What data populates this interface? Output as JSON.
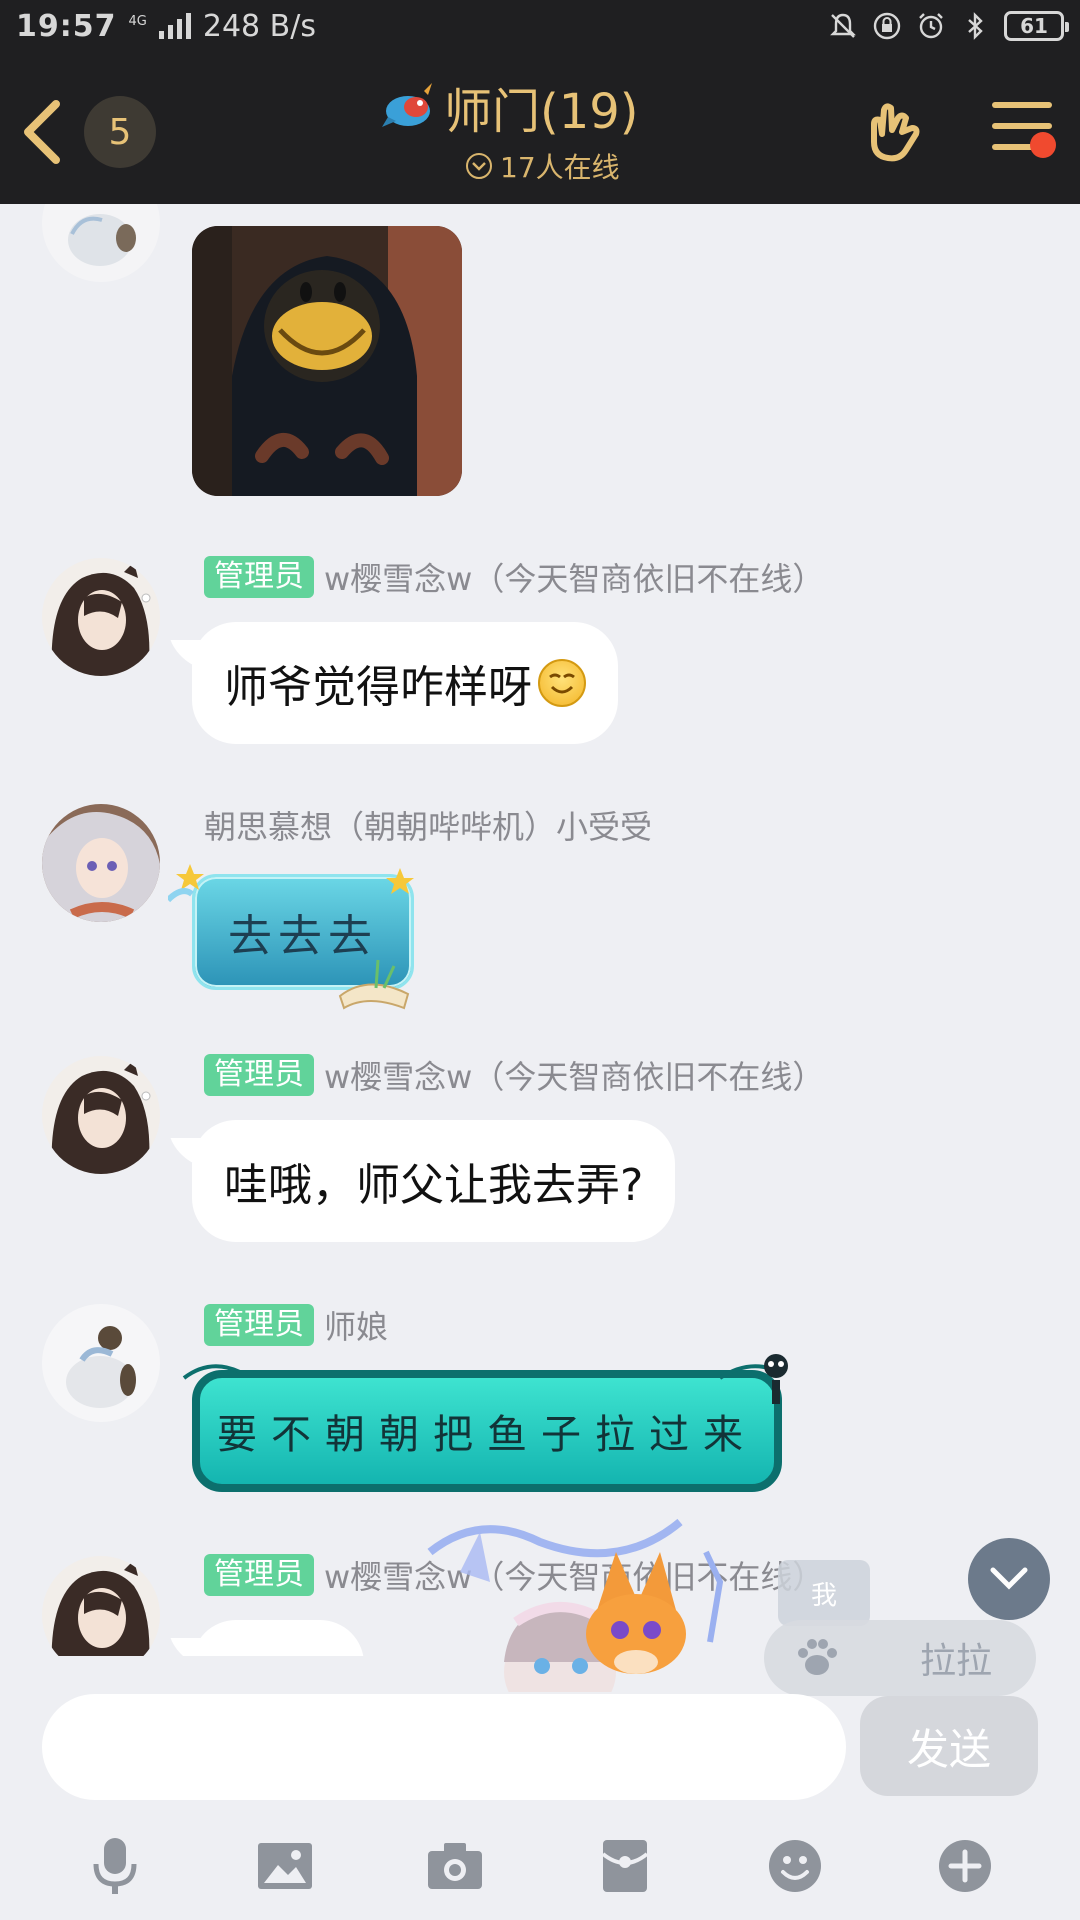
{
  "status_bar": {
    "time": "19:57",
    "network_type": "4G",
    "speed": "248 B/s",
    "battery": "61"
  },
  "header": {
    "unread_count": "5",
    "group_title": "师门(19)",
    "online_text": "17人在线"
  },
  "messages": [
    {
      "type": "image"
    },
    {
      "role": "管理员",
      "sender": "w樱雪念w（今天智商依旧不在线）",
      "text": "师爷觉得咋样呀"
    },
    {
      "role": "",
      "sender": "朝思慕想（朝朝哔哔机）小受受",
      "text": "去去去"
    },
    {
      "role": "管理员",
      "sender": "w樱雪念w（今天智商依旧不在线）",
      "text": "哇哦，师父让我去弄?"
    },
    {
      "role": "管理员",
      "sender": "师娘",
      "text": "要不朝朝把鱼子拉过来"
    },
    {
      "role": "管理员",
      "sender": "w樱雪念w（今天智商依旧不在线）",
      "text": ""
    }
  ],
  "overlay": {
    "me_label": "我",
    "pat_label": "拉拉"
  },
  "input": {
    "value": "",
    "send_label": "发送"
  },
  "toolbar": {
    "icons": [
      "microphone-icon",
      "image-icon",
      "camera-icon",
      "red-packet-icon",
      "emoji-icon",
      "plus-icon"
    ]
  },
  "colors": {
    "header_bg": "#1f1f21",
    "accent_gold": "#e7c277",
    "admin_tag": "#61d39a",
    "chat_bg": "#eeeff3",
    "notify_dot": "#f04a2f"
  }
}
